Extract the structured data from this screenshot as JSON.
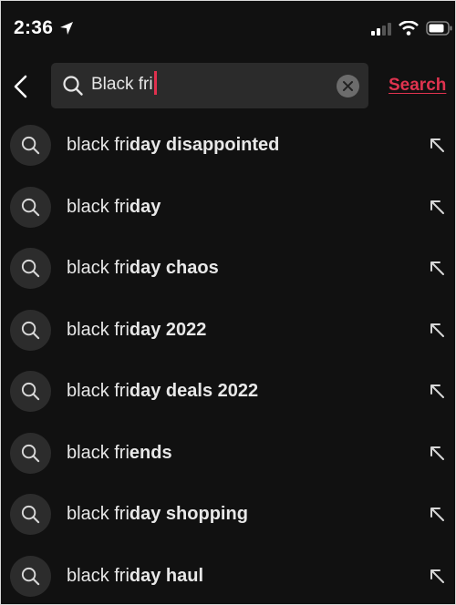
{
  "status_bar": {
    "time": "2:36",
    "location_icon": "location-arrow-icon",
    "signal_icon": "cellular-signal-icon",
    "wifi_icon": "wifi-icon",
    "battery_icon": "battery-icon"
  },
  "search_bar": {
    "back_icon": "chevron-left-icon",
    "search_icon": "search-icon",
    "query": "Black fri",
    "clear_icon": "clear-icon",
    "search_button_label": "Search",
    "accent_color": "#e0334f"
  },
  "suggestions": [
    {
      "typed": "black fri",
      "completion": "day disappointed"
    },
    {
      "typed": "black fri",
      "completion": "day"
    },
    {
      "typed": "black fri",
      "completion": "day chaos"
    },
    {
      "typed": "black fri",
      "completion": "day 2022"
    },
    {
      "typed": "black fri",
      "completion": "day deals 2022"
    },
    {
      "typed": "black fri",
      "completion": "ends"
    },
    {
      "typed": "black fri",
      "completion": "day shopping"
    },
    {
      "typed": "black fri",
      "completion": "day haul"
    }
  ]
}
